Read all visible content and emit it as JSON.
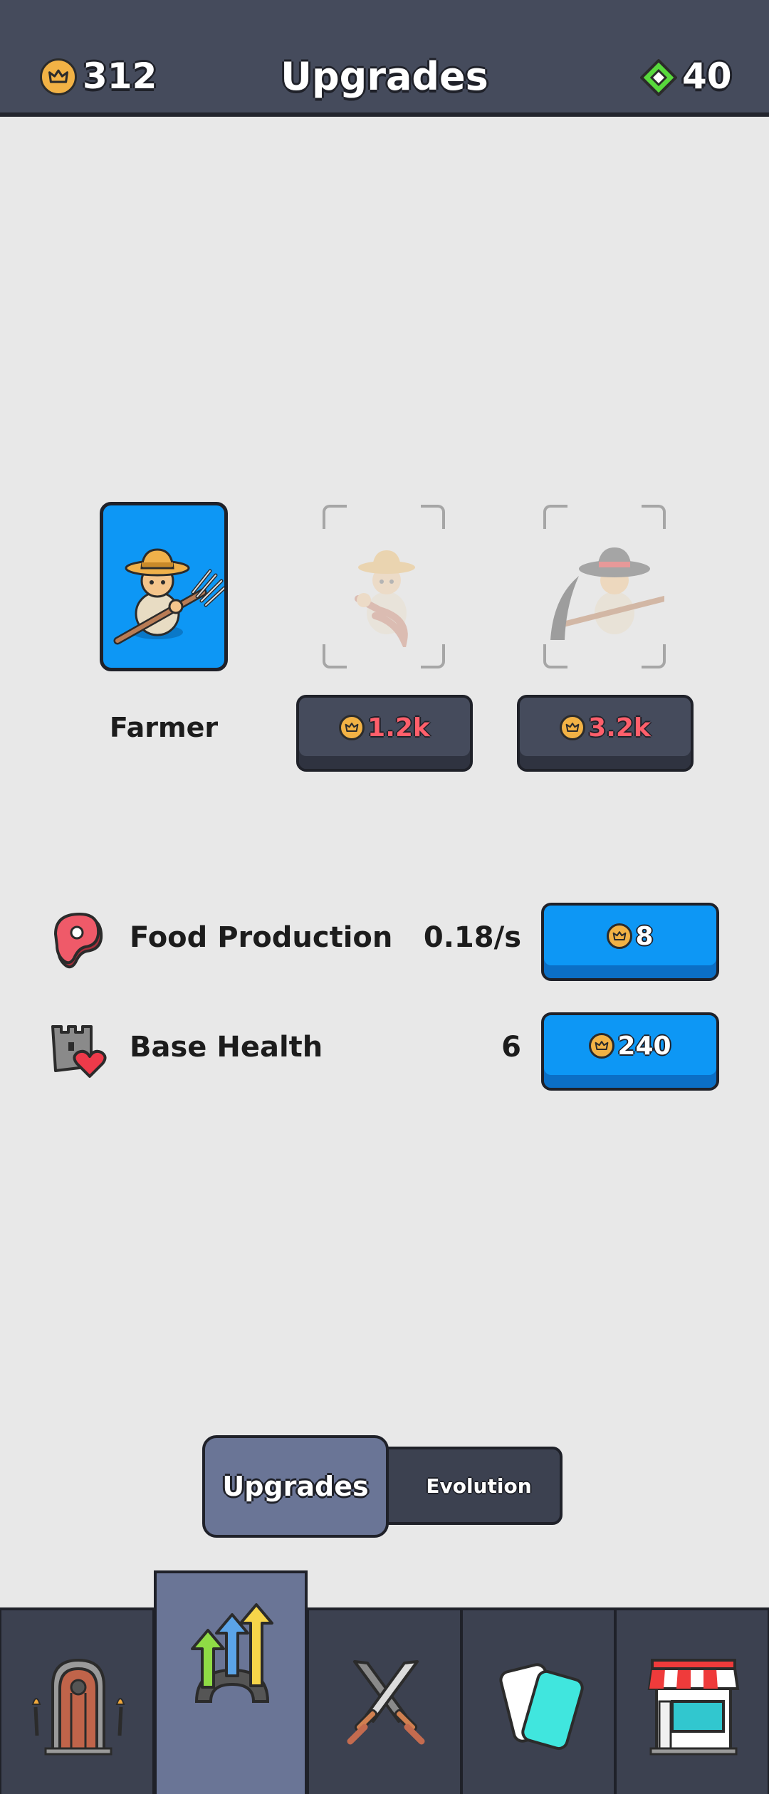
{
  "header": {
    "title": "Upgrades",
    "coins": "312",
    "gems": "40",
    "coin_icon": "crown-coin-icon",
    "gem_icon": "green-gem-icon"
  },
  "characters": [
    {
      "name": "Farmer",
      "state": "unlocked",
      "selected": true
    },
    {
      "name": "",
      "state": "locked",
      "price": "1.2k"
    },
    {
      "name": "",
      "state": "locked",
      "price": "3.2k"
    }
  ],
  "upgrades": [
    {
      "label": "Food Production",
      "value": "0.18/s",
      "cost": "8",
      "icon": "meat-icon"
    },
    {
      "label": "Base Health",
      "value": "6",
      "cost": "240",
      "icon": "castle-heart-icon"
    }
  ],
  "segment_tabs": {
    "upgrades": "Upgrades",
    "evolution": "Evolution",
    "active": "Upgrades"
  },
  "bottom_nav": [
    {
      "id": "door",
      "icon": "door-icon"
    },
    {
      "id": "upgrades",
      "icon": "upgrade-arrows-icon",
      "selected": true
    },
    {
      "id": "battle",
      "icon": "crossed-swords-icon"
    },
    {
      "id": "cards",
      "icon": "cards-icon"
    },
    {
      "id": "shop",
      "icon": "shop-icon"
    }
  ],
  "colors": {
    "header_bg": "#454b5c",
    "accent_blue": "#0d97f5",
    "price_red": "#ff5f6b",
    "coin_gold": "#f2b245",
    "gem_green": "#58d93c",
    "nav_selected": "#6a7596"
  }
}
